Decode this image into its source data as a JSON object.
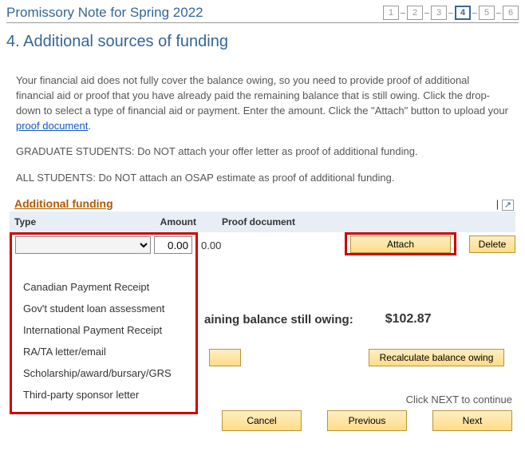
{
  "header": {
    "title": "Promissory Note for Spring 2022",
    "steps": [
      "1",
      "2",
      "3",
      "4",
      "5",
      "6"
    ],
    "active_step_index": 3
  },
  "section": {
    "heading": "4. Additional sources of funding"
  },
  "intro": {
    "p1a": "Your financial aid does not fully cover the balance owing, so you need to provide proof of additional financial aid or proof that you have already paid the remaining balance that is still owing. Click the drop-down to select a type of financial aid or payment. Enter the amount. Click the \"Attach\" button to upload your ",
    "p1_link": "proof document",
    "p1b": ".",
    "p2": "GRADUATE STUDENTS: Do NOT attach your offer letter as proof of additional funding.",
    "p3": "ALL STUDENTS: Do NOT attach an OSAP estimate as proof of additional funding."
  },
  "panel": {
    "title": "Additional funding",
    "popout_glyph": "↗"
  },
  "columns": {
    "type": "Type",
    "amount": "Amount",
    "proof": "Proof document"
  },
  "row": {
    "amount_value": "0.00",
    "attach_label": "Attach",
    "delete_label": "Delete"
  },
  "dropdown_options": [
    "Canadian Payment Receipt",
    "Gov't student loan assessment",
    "International Payment Receipt",
    "RA/TA letter/email",
    "Scholarship/award/bursary/GRS",
    "Third-party sponsor letter"
  ],
  "balance": {
    "label": "aining balance still owing:",
    "value": "$102.87"
  },
  "mid_buttons": {
    "plus": "",
    "recalc": "Recalculate balance owing"
  },
  "footer": {
    "hint": "Click NEXT to continue",
    "cancel": "Cancel",
    "previous": "Previous",
    "next": "Next"
  }
}
